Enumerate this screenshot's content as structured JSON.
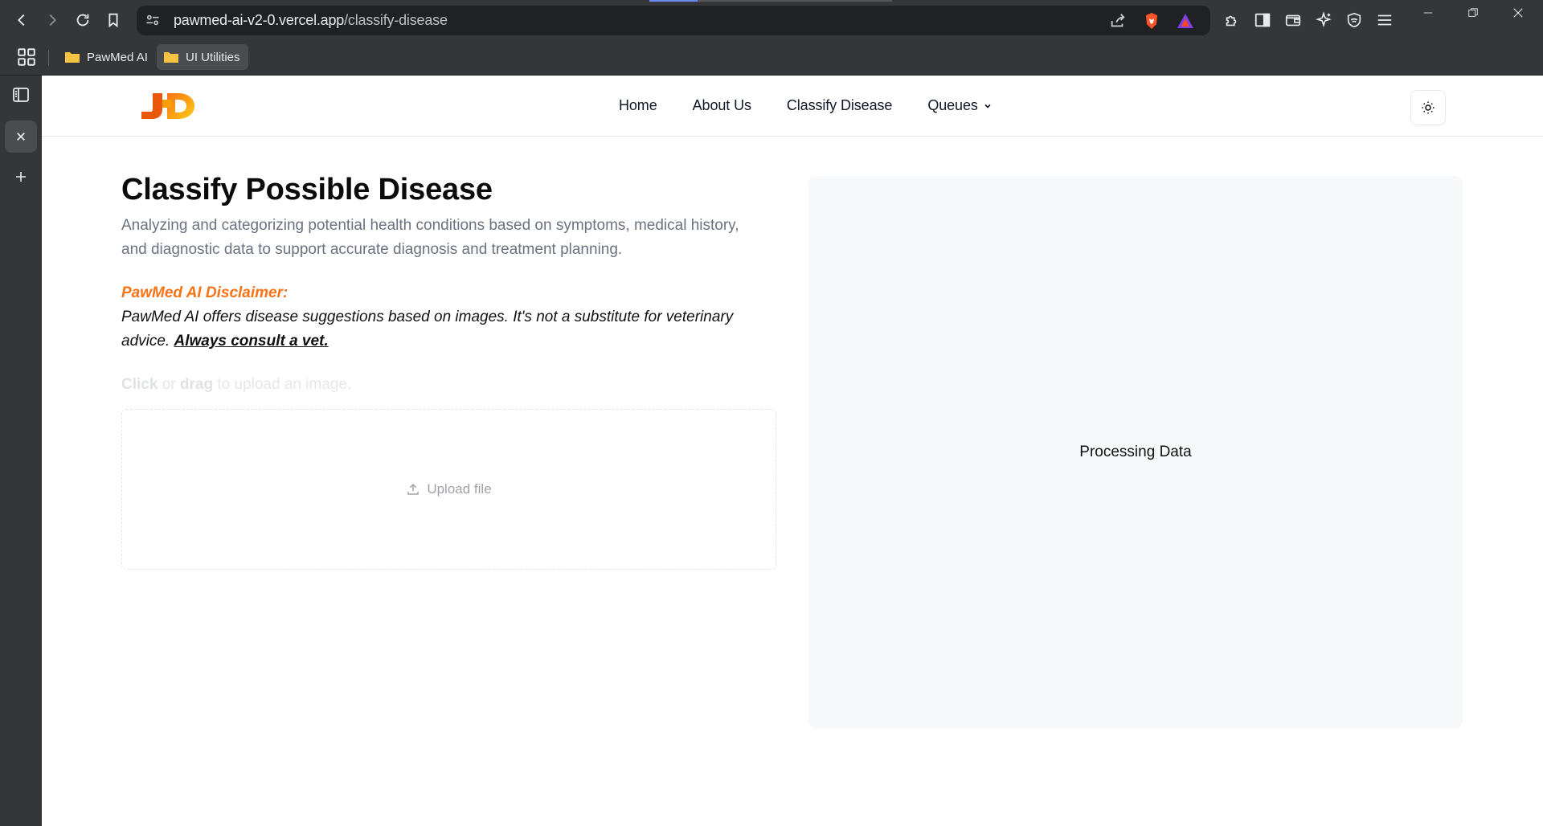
{
  "browser": {
    "url_host": "pawmed-ai-v2-0.vercel.app",
    "url_path": "/classify-disease",
    "bookmarks": [
      {
        "label": "PawMed AI"
      },
      {
        "label": "UI Utilities"
      }
    ]
  },
  "nav": {
    "links": [
      "Home",
      "About Us",
      "Classify Disease",
      "Queues"
    ]
  },
  "main": {
    "title": "Classify Possible Disease",
    "subtitle": "Analyzing and categorizing potential health conditions based on symptoms, medical history, and diagnostic data to support accurate diagnosis and treatment planning.",
    "disclaimer_title": "PawMed AI Disclaimer:",
    "disclaimer_text": "PawMed AI offers disease suggestions based on images. It's not a substitute for veterinary advice.",
    "disclaimer_link": "Always consult a vet.",
    "upload_hint_click": "Click",
    "upload_hint_or": "or",
    "upload_hint_drag": "drag",
    "upload_hint_rest": "to upload an image.",
    "upload_label": "Upload file",
    "result_status": "Processing Data"
  },
  "colors": {
    "accent": "#f97316",
    "chrome_bg": "#35363a",
    "panel_bg": "#f8f9fa"
  }
}
